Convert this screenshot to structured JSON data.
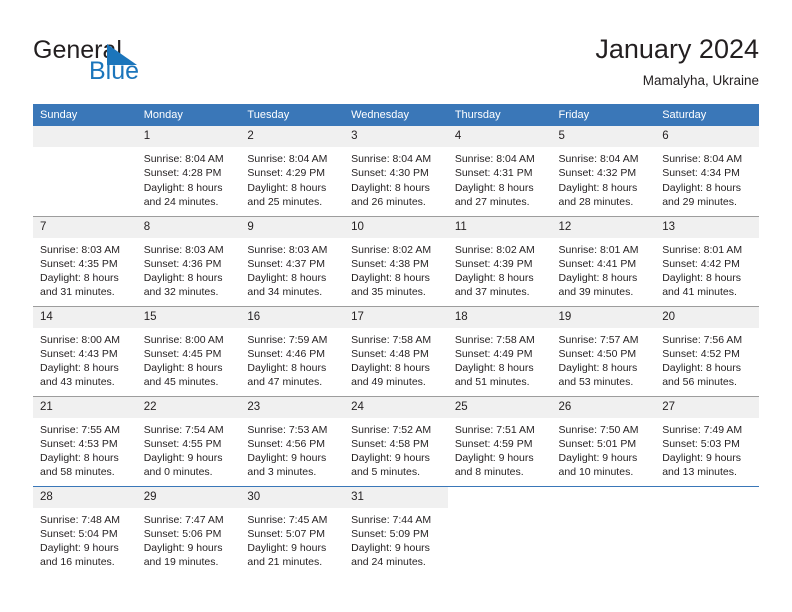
{
  "brand": {
    "name_part1": "General",
    "name_part2": "Blue",
    "triangle_color": "#1b75bb",
    "text_color": "#231f20"
  },
  "header": {
    "title": "January 2024",
    "subtitle": "Mamalyha, Ukraine"
  },
  "theme": {
    "header_bg": "#3a77b8",
    "header_text": "#ffffff",
    "daynum_bg": "#f0f0f0",
    "grid_line": "#9d9d9d",
    "body_text": "#231f20"
  },
  "weekdays": [
    "Sunday",
    "Monday",
    "Tuesday",
    "Wednesday",
    "Thursday",
    "Friday",
    "Saturday"
  ],
  "days": {
    "d1": {
      "num": "1",
      "detail": "Sunrise: 8:04 AM\nSunset: 4:28 PM\nDaylight: 8 hours\nand 24 minutes."
    },
    "d2": {
      "num": "2",
      "detail": "Sunrise: 8:04 AM\nSunset: 4:29 PM\nDaylight: 8 hours\nand 25 minutes."
    },
    "d3": {
      "num": "3",
      "detail": "Sunrise: 8:04 AM\nSunset: 4:30 PM\nDaylight: 8 hours\nand 26 minutes."
    },
    "d4": {
      "num": "4",
      "detail": "Sunrise: 8:04 AM\nSunset: 4:31 PM\nDaylight: 8 hours\nand 27 minutes."
    },
    "d5": {
      "num": "5",
      "detail": "Sunrise: 8:04 AM\nSunset: 4:32 PM\nDaylight: 8 hours\nand 28 minutes."
    },
    "d6": {
      "num": "6",
      "detail": "Sunrise: 8:04 AM\nSunset: 4:34 PM\nDaylight: 8 hours\nand 29 minutes."
    },
    "d7": {
      "num": "7",
      "detail": "Sunrise: 8:03 AM\nSunset: 4:35 PM\nDaylight: 8 hours\nand 31 minutes."
    },
    "d8": {
      "num": "8",
      "detail": "Sunrise: 8:03 AM\nSunset: 4:36 PM\nDaylight: 8 hours\nand 32 minutes."
    },
    "d9": {
      "num": "9",
      "detail": "Sunrise: 8:03 AM\nSunset: 4:37 PM\nDaylight: 8 hours\nand 34 minutes."
    },
    "d10": {
      "num": "10",
      "detail": "Sunrise: 8:02 AM\nSunset: 4:38 PM\nDaylight: 8 hours\nand 35 minutes."
    },
    "d11": {
      "num": "11",
      "detail": "Sunrise: 8:02 AM\nSunset: 4:39 PM\nDaylight: 8 hours\nand 37 minutes."
    },
    "d12": {
      "num": "12",
      "detail": "Sunrise: 8:01 AM\nSunset: 4:41 PM\nDaylight: 8 hours\nand 39 minutes."
    },
    "d13": {
      "num": "13",
      "detail": "Sunrise: 8:01 AM\nSunset: 4:42 PM\nDaylight: 8 hours\nand 41 minutes."
    },
    "d14": {
      "num": "14",
      "detail": "Sunrise: 8:00 AM\nSunset: 4:43 PM\nDaylight: 8 hours\nand 43 minutes."
    },
    "d15": {
      "num": "15",
      "detail": "Sunrise: 8:00 AM\nSunset: 4:45 PM\nDaylight: 8 hours\nand 45 minutes."
    },
    "d16": {
      "num": "16",
      "detail": "Sunrise: 7:59 AM\nSunset: 4:46 PM\nDaylight: 8 hours\nand 47 minutes."
    },
    "d17": {
      "num": "17",
      "detail": "Sunrise: 7:58 AM\nSunset: 4:48 PM\nDaylight: 8 hours\nand 49 minutes."
    },
    "d18": {
      "num": "18",
      "detail": "Sunrise: 7:58 AM\nSunset: 4:49 PM\nDaylight: 8 hours\nand 51 minutes."
    },
    "d19": {
      "num": "19",
      "detail": "Sunrise: 7:57 AM\nSunset: 4:50 PM\nDaylight: 8 hours\nand 53 minutes."
    },
    "d20": {
      "num": "20",
      "detail": "Sunrise: 7:56 AM\nSunset: 4:52 PM\nDaylight: 8 hours\nand 56 minutes."
    },
    "d21": {
      "num": "21",
      "detail": "Sunrise: 7:55 AM\nSunset: 4:53 PM\nDaylight: 8 hours\nand 58 minutes."
    },
    "d22": {
      "num": "22",
      "detail": "Sunrise: 7:54 AM\nSunset: 4:55 PM\nDaylight: 9 hours\nand 0 minutes."
    },
    "d23": {
      "num": "23",
      "detail": "Sunrise: 7:53 AM\nSunset: 4:56 PM\nDaylight: 9 hours\nand 3 minutes."
    },
    "d24": {
      "num": "24",
      "detail": "Sunrise: 7:52 AM\nSunset: 4:58 PM\nDaylight: 9 hours\nand 5 minutes."
    },
    "d25": {
      "num": "25",
      "detail": "Sunrise: 7:51 AM\nSunset: 4:59 PM\nDaylight: 9 hours\nand 8 minutes."
    },
    "d26": {
      "num": "26",
      "detail": "Sunrise: 7:50 AM\nSunset: 5:01 PM\nDaylight: 9 hours\nand 10 minutes."
    },
    "d27": {
      "num": "27",
      "detail": "Sunrise: 7:49 AM\nSunset: 5:03 PM\nDaylight: 9 hours\nand 13 minutes."
    },
    "d28": {
      "num": "28",
      "detail": "Sunrise: 7:48 AM\nSunset: 5:04 PM\nDaylight: 9 hours\nand 16 minutes."
    },
    "d29": {
      "num": "29",
      "detail": "Sunrise: 7:47 AM\nSunset: 5:06 PM\nDaylight: 9 hours\nand 19 minutes."
    },
    "d30": {
      "num": "30",
      "detail": "Sunrise: 7:45 AM\nSunset: 5:07 PM\nDaylight: 9 hours\nand 21 minutes."
    },
    "d31": {
      "num": "31",
      "detail": "Sunrise: 7:44 AM\nSunset: 5:09 PM\nDaylight: 9 hours\nand 24 minutes."
    }
  }
}
